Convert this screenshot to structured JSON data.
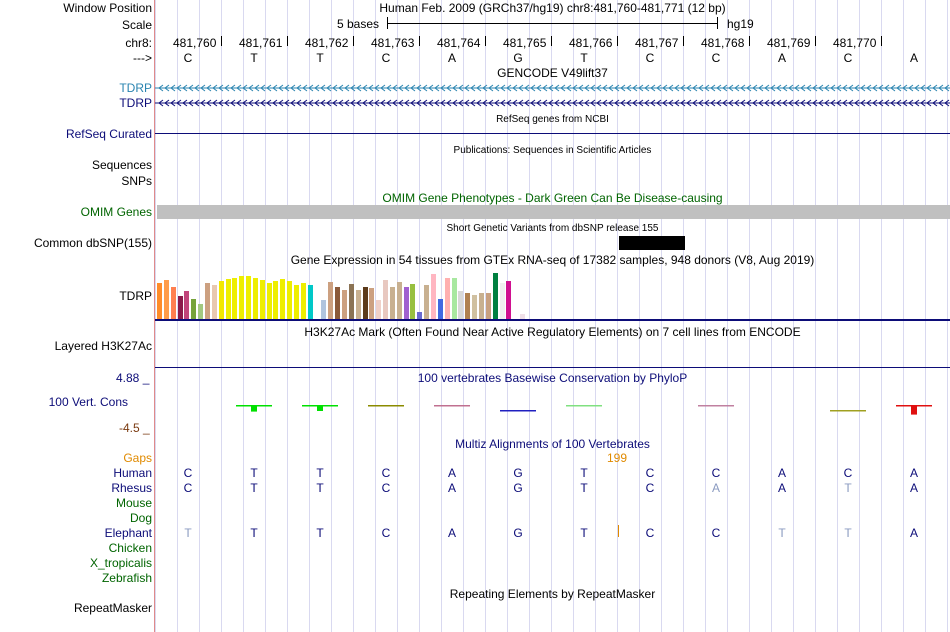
{
  "header": {
    "window_position_label": "Window Position",
    "window_position_value": "Human Feb. 2009 (GRCh37/hg19)   chr8:481,760-481,771 (12 bp)",
    "scale_label": "Scale",
    "scale_text": "5 bases",
    "scale_assembly": "hg19",
    "chrom_label": "chr8:",
    "arrow_label": "--->",
    "positions": [
      "481,760",
      "481,761",
      "481,762",
      "481,763",
      "481,764",
      "481,765",
      "481,766",
      "481,767",
      "481,768",
      "481,769",
      "481,770"
    ],
    "bases": [
      "C",
      "T",
      "T",
      "C",
      "A",
      "G",
      "T",
      "C",
      "C",
      "A",
      "C",
      "A"
    ]
  },
  "tracks": {
    "gencode_title": "GENCODE V49lift37",
    "gencode_rows": [
      "TDRP",
      "TDRP"
    ],
    "refseq_title": "RefSeq genes from NCBI",
    "refseq_label": "RefSeq Curated",
    "publications_title": "Publications: Sequences in Scientific Articles",
    "sequences_label": "Sequences",
    "snps_label": "SNPs",
    "omim_title": "OMIM Gene Phenotypes - Dark Green Can Be Disease-causing",
    "omim_label": "OMIM Genes",
    "dbsnp_title": "Short Genetic Variants from dbSNP release 155",
    "dbsnp_label": "Common dbSNP(155)",
    "gtex_title": "Gene Expression in 54 tissues from GTEx RNA-seq of 17382 samples, 948 donors (V8, Aug 2019)",
    "gtex_label": "TDRP",
    "h3k27ac_title": "H3K27Ac Mark (Often Found Near Active Regulatory Elements) on 7 cell lines from ENCODE",
    "h3k27ac_label": "Layered H3K27Ac",
    "phylop_title": "100 vertebrates Basewise Conservation by PhyloP",
    "phylop_label": "100 Vert. Cons",
    "phylop_max": "4.88 _",
    "phylop_min": "-4.5 _",
    "multiz_title": "Multiz Alignments of 100 Vertebrates",
    "gap_label": "Gaps",
    "gap_count": "199",
    "repeat_title": "Repeating Elements by RepeatMasker",
    "repeat_label": "RepeatMasker"
  },
  "alignment": {
    "species": [
      {
        "name": "Human",
        "bases": [
          "C",
          "T",
          "T",
          "C",
          "A",
          "G",
          "T",
          "C",
          "C",
          "A",
          "C",
          "A"
        ],
        "faded": []
      },
      {
        "name": "Rhesus",
        "bases": [
          "C",
          "T",
          "T",
          "C",
          "A",
          "G",
          "T",
          "C",
          "A",
          "A",
          "T",
          "A"
        ],
        "faded": [
          8,
          10
        ]
      },
      {
        "name": "Mouse",
        "bases": [],
        "faded": []
      },
      {
        "name": "Dog",
        "bases": [],
        "faded": []
      },
      {
        "name": "Elephant",
        "bases": [
          "T",
          "T",
          "T",
          "C",
          "A",
          "G",
          "T",
          "C",
          "C",
          "T",
          "T",
          "A"
        ],
        "faded": [
          0,
          9,
          10
        ]
      },
      {
        "name": "Chicken",
        "bases": [],
        "faded": []
      },
      {
        "name": "X_tropicalis",
        "bases": [],
        "faded": []
      },
      {
        "name": "Zebrafish",
        "bases": [],
        "faded": []
      }
    ]
  },
  "colors": {
    "navy": "#0c0c78",
    "gencode_teal": "#2a84b0",
    "omim_bar": "#c0c0c0",
    "dbsnp_block": "#000000",
    "gap_orange": "#e08a00",
    "grid_line": "#d9d9f0"
  },
  "gtex_expression": [
    {
      "color": "#ff8c2a",
      "value": 0.7
    },
    {
      "color": "#ff9c4a",
      "value": 0.76
    },
    {
      "color": "#ff7f50",
      "value": 0.62
    },
    {
      "color": "#8b1a4a",
      "value": 0.45
    },
    {
      "color": "#c1447a",
      "value": 0.55
    },
    {
      "color": "#76a33a",
      "value": 0.4
    },
    {
      "color": "#a2c880",
      "value": 0.3
    },
    {
      "color": "#cca080",
      "value": 0.7
    },
    {
      "color": "#e8c8b0",
      "value": 0.66
    },
    {
      "color": "#f2e800",
      "value": 0.74
    },
    {
      "color": "#eeee00",
      "value": 0.78
    },
    {
      "color": "#eeee00",
      "value": 0.8
    },
    {
      "color": "#eeee00",
      "value": 0.84
    },
    {
      "color": "#eeee00",
      "value": 0.84
    },
    {
      "color": "#eeee00",
      "value": 0.8
    },
    {
      "color": "#eeee00",
      "value": 0.76
    },
    {
      "color": "#eeee00",
      "value": 0.7
    },
    {
      "color": "#eeee00",
      "value": 0.74
    },
    {
      "color": "#eeee00",
      "value": 0.78
    },
    {
      "color": "#eeee00",
      "value": 0.74
    },
    {
      "color": "#eeee00",
      "value": 0.66
    },
    {
      "color": "#eeee00",
      "value": 0.7
    },
    {
      "color": "#00c8c8",
      "value": 0.66
    },
    {
      "color": "#ffffff",
      "value": 0.0
    },
    {
      "color": "#b0c4de",
      "value": 0.38
    },
    {
      "color": "#cca080",
      "value": 0.72
    },
    {
      "color": "#8b5a3a",
      "value": 0.62
    },
    {
      "color": "#cca080",
      "value": 0.56
    },
    {
      "color": "#8b7355",
      "value": 0.68
    },
    {
      "color": "#c8b090",
      "value": 0.56
    },
    {
      "color": "#5c3a1a",
      "value": 0.62
    },
    {
      "color": "#cca080",
      "value": 0.6
    },
    {
      "color": "#f0d0c8",
      "value": 0.38
    },
    {
      "color": "#e8c8c0",
      "value": 0.76
    },
    {
      "color": "#c8b090",
      "value": 0.62
    },
    {
      "color": "#c8b090",
      "value": 0.72
    },
    {
      "color": "#a060d0",
      "value": 0.62
    },
    {
      "color": "#98c040",
      "value": 0.68
    },
    {
      "color": "#6a6ad0",
      "value": 0.14
    },
    {
      "color": "#c8b090",
      "value": 0.66
    },
    {
      "color": "#ffb6c1",
      "value": 0.88
    },
    {
      "color": "#4169e1",
      "value": 0.4
    },
    {
      "color": "#ffb0b0",
      "value": 0.8
    },
    {
      "color": "#a8e8a0",
      "value": 0.8
    },
    {
      "color": "#d8d8d8",
      "value": 0.54
    },
    {
      "color": "#b08050",
      "value": 0.5
    },
    {
      "color": "#d0c0a0",
      "value": 0.48
    },
    {
      "color": "#c8b090",
      "value": 0.5
    },
    {
      "color": "#c8a080",
      "value": 0.5
    },
    {
      "color": "#008040",
      "value": 0.9
    },
    {
      "color": "#f0f0f0",
      "value": 0.7
    },
    {
      "color": "#d01090",
      "value": 0.74
    },
    {
      "color": "#ffffff",
      "value": 0.0
    },
    {
      "color": "#f0e0e8",
      "value": 0.1
    }
  ],
  "phylop": {
    "max": 4.88,
    "min": -4.5,
    "values": [
      0,
      2.2,
      2.0,
      0.3,
      0.1,
      -0.1,
      0.1,
      0,
      0.1,
      0,
      -0.4,
      3.2
    ],
    "colors": [
      "#000000",
      "#00e000",
      "#00e000",
      "#8b8b00",
      "#c07090",
      "#2020c0",
      "#80e080",
      "#000000",
      "#c080a0",
      "#000000",
      "#a0a020",
      "#e01010"
    ]
  }
}
